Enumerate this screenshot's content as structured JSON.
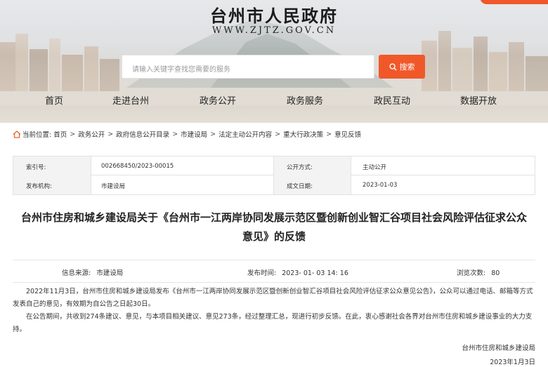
{
  "header": {
    "site_title": "台州市人民政府",
    "site_url": "WWW.ZJTZ.GOV.CN",
    "search": {
      "placeholder": "请输入关键字查找您需要的服务",
      "button_label": "搜索",
      "button_icon": "search-icon"
    },
    "nav": [
      "首页",
      "走进台州",
      "政务公开",
      "政务服务",
      "政民互动",
      "数据开放"
    ],
    "accent_color": "#f0582a"
  },
  "breadcrumb": {
    "prefix": "当前位置:",
    "icon": "home-icon",
    "items": [
      "首页",
      "政务公开",
      "政府信息公开目录",
      "市建设局",
      "法定主动公开内容",
      "重大行政决策",
      "意见反馈"
    ]
  },
  "info": {
    "index_label": "索引号:",
    "index_value": "002668450/2023-00015",
    "mode_label": "公开方式:",
    "mode_value": "主动公开",
    "org_label": "发布机构:",
    "org_value": "市建设局",
    "date_label": "成文日期:",
    "date_value": "2023-01-03"
  },
  "article": {
    "title_line1": "台州市住房和城乡建设局关于《台州市一江两岸协同发展示范区暨创新创业智汇谷项目社会风险评估征求公众",
    "title_line2": "意见》的反馈",
    "source_label": "信息来源:",
    "source_value": "市建设局",
    "publish_label": "发布时间:",
    "publish_value": "2023- 01- 03 14: 16",
    "views_label": "浏览次数:",
    "views_value": "80",
    "paragraph1": "2022年11月3日，台州市住房和城乡建设局发布《台州市一江两岸协同发展示范区暨创新创业智汇谷项目社会风险评估征求公众意见公告》，公众可以通过电话、邮箱等方式发表自己的意见，有效期为自公告之日起30日。",
    "paragraph2": "在公告期间，共收到274条建议、意见，与本项目相关建议、意见273条，经过整理汇总，现进行初步反馈。在此，衷心感谢社会各界对台州市住房和城乡建设事业的大力支持。",
    "signature_org": "台州市住房和城乡建设局",
    "signature_date": "2023年1月3日"
  }
}
